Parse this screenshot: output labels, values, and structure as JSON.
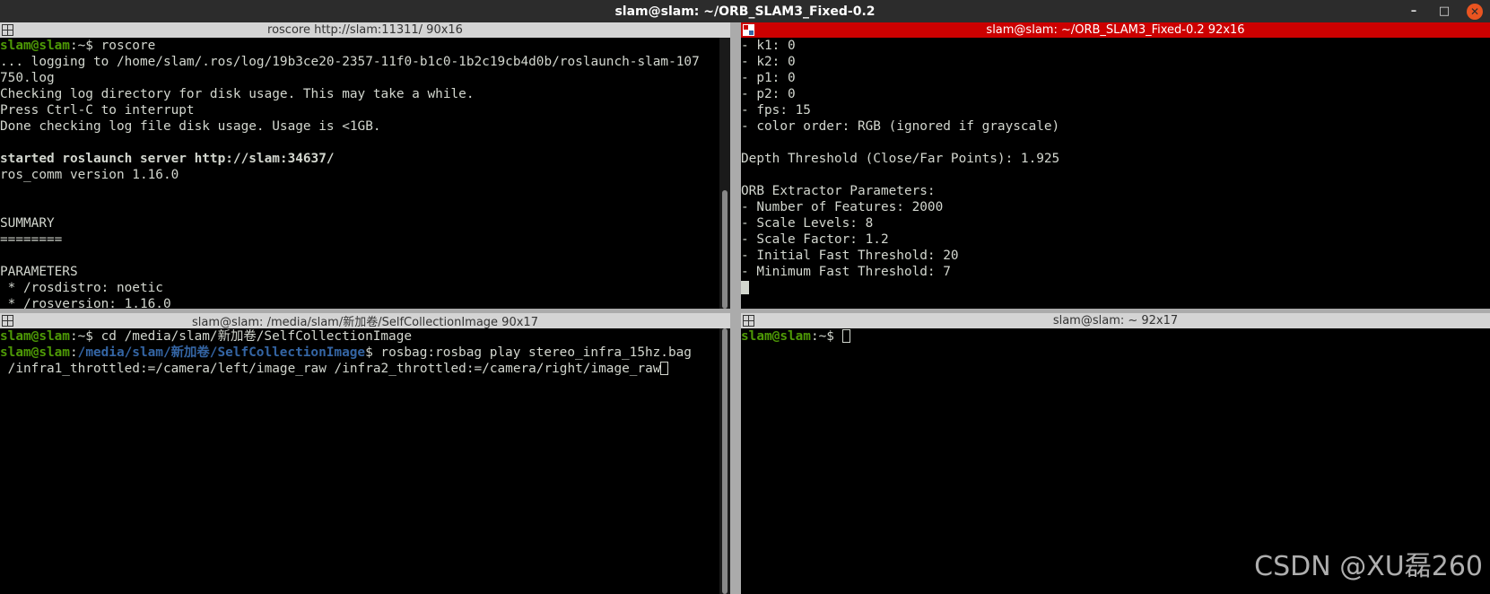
{
  "window": {
    "title": "slam@slam: ~/ORB_SLAM3_Fixed-0.2",
    "minimize": "–",
    "maximize": "□",
    "close": "✕"
  },
  "panes": {
    "top_left": {
      "title": "roscore http://slam:11311/ 90x16",
      "prompt_user": "slam@slam",
      "prompt_sep": ":~$ ",
      "command": "roscore",
      "lines": [
        "... logging to /home/slam/.ros/log/19b3ce20-2357-11f0-b1c0-1b2c19cb4d0b/roslaunch-slam-107",
        "750.log",
        "Checking log directory for disk usage. This may take a while.",
        "Press Ctrl-C to interrupt",
        "Done checking log file disk usage. Usage is <1GB.",
        "",
        "started roslaunch server http://slam:34637/",
        "ros_comm version 1.16.0",
        "",
        "",
        "SUMMARY",
        "========",
        "",
        "PARAMETERS",
        " * /rosdistro: noetic",
        " * /rosversion: 1.16.0"
      ],
      "bold_line_index": 6
    },
    "top_right": {
      "title": "slam@slam: ~/ORB_SLAM3_Fixed-0.2 92x16",
      "lines": [
        "- k1: 0",
        "- k2: 0",
        "- p1: 0",
        "- p2: 0",
        "- fps: 15",
        "- color order: RGB (ignored if grayscale)",
        "",
        "Depth Threshold (Close/Far Points): 1.925",
        "",
        "ORB Extractor Parameters:",
        "- Number of Features: 2000",
        "- Scale Levels: 8",
        "- Scale Factor: 1.2",
        "- Initial Fast Threshold: 20",
        "- Minimum Fast Threshold: 7"
      ]
    },
    "bottom_left": {
      "title": "slam@slam: /media/slam/新加卷/SelfCollectionImage 90x17",
      "line1_user": "slam@slam",
      "line1_sep": ":~$ ",
      "line1_cmd": "cd /media/slam/新加卷/SelfCollectionImage",
      "line2_user": "slam@slam",
      "line2_sep": ":",
      "line2_dir": "/media/slam/新加卷/SelfCollectionImage",
      "line2_dollar": "$ ",
      "line2_cmd": "rosbag:rosbag play stereo_infra_15hz.bag",
      "line3": " /infra1_throttled:=/camera/left/image_raw /infra2_throttled:=/camera/right/image_raw"
    },
    "bottom_right": {
      "title": "slam@slam: ~ 92x17",
      "prompt_user": "slam@slam",
      "prompt_sep": ":~$ "
    }
  },
  "watermark": "CSDN @XU磊260"
}
